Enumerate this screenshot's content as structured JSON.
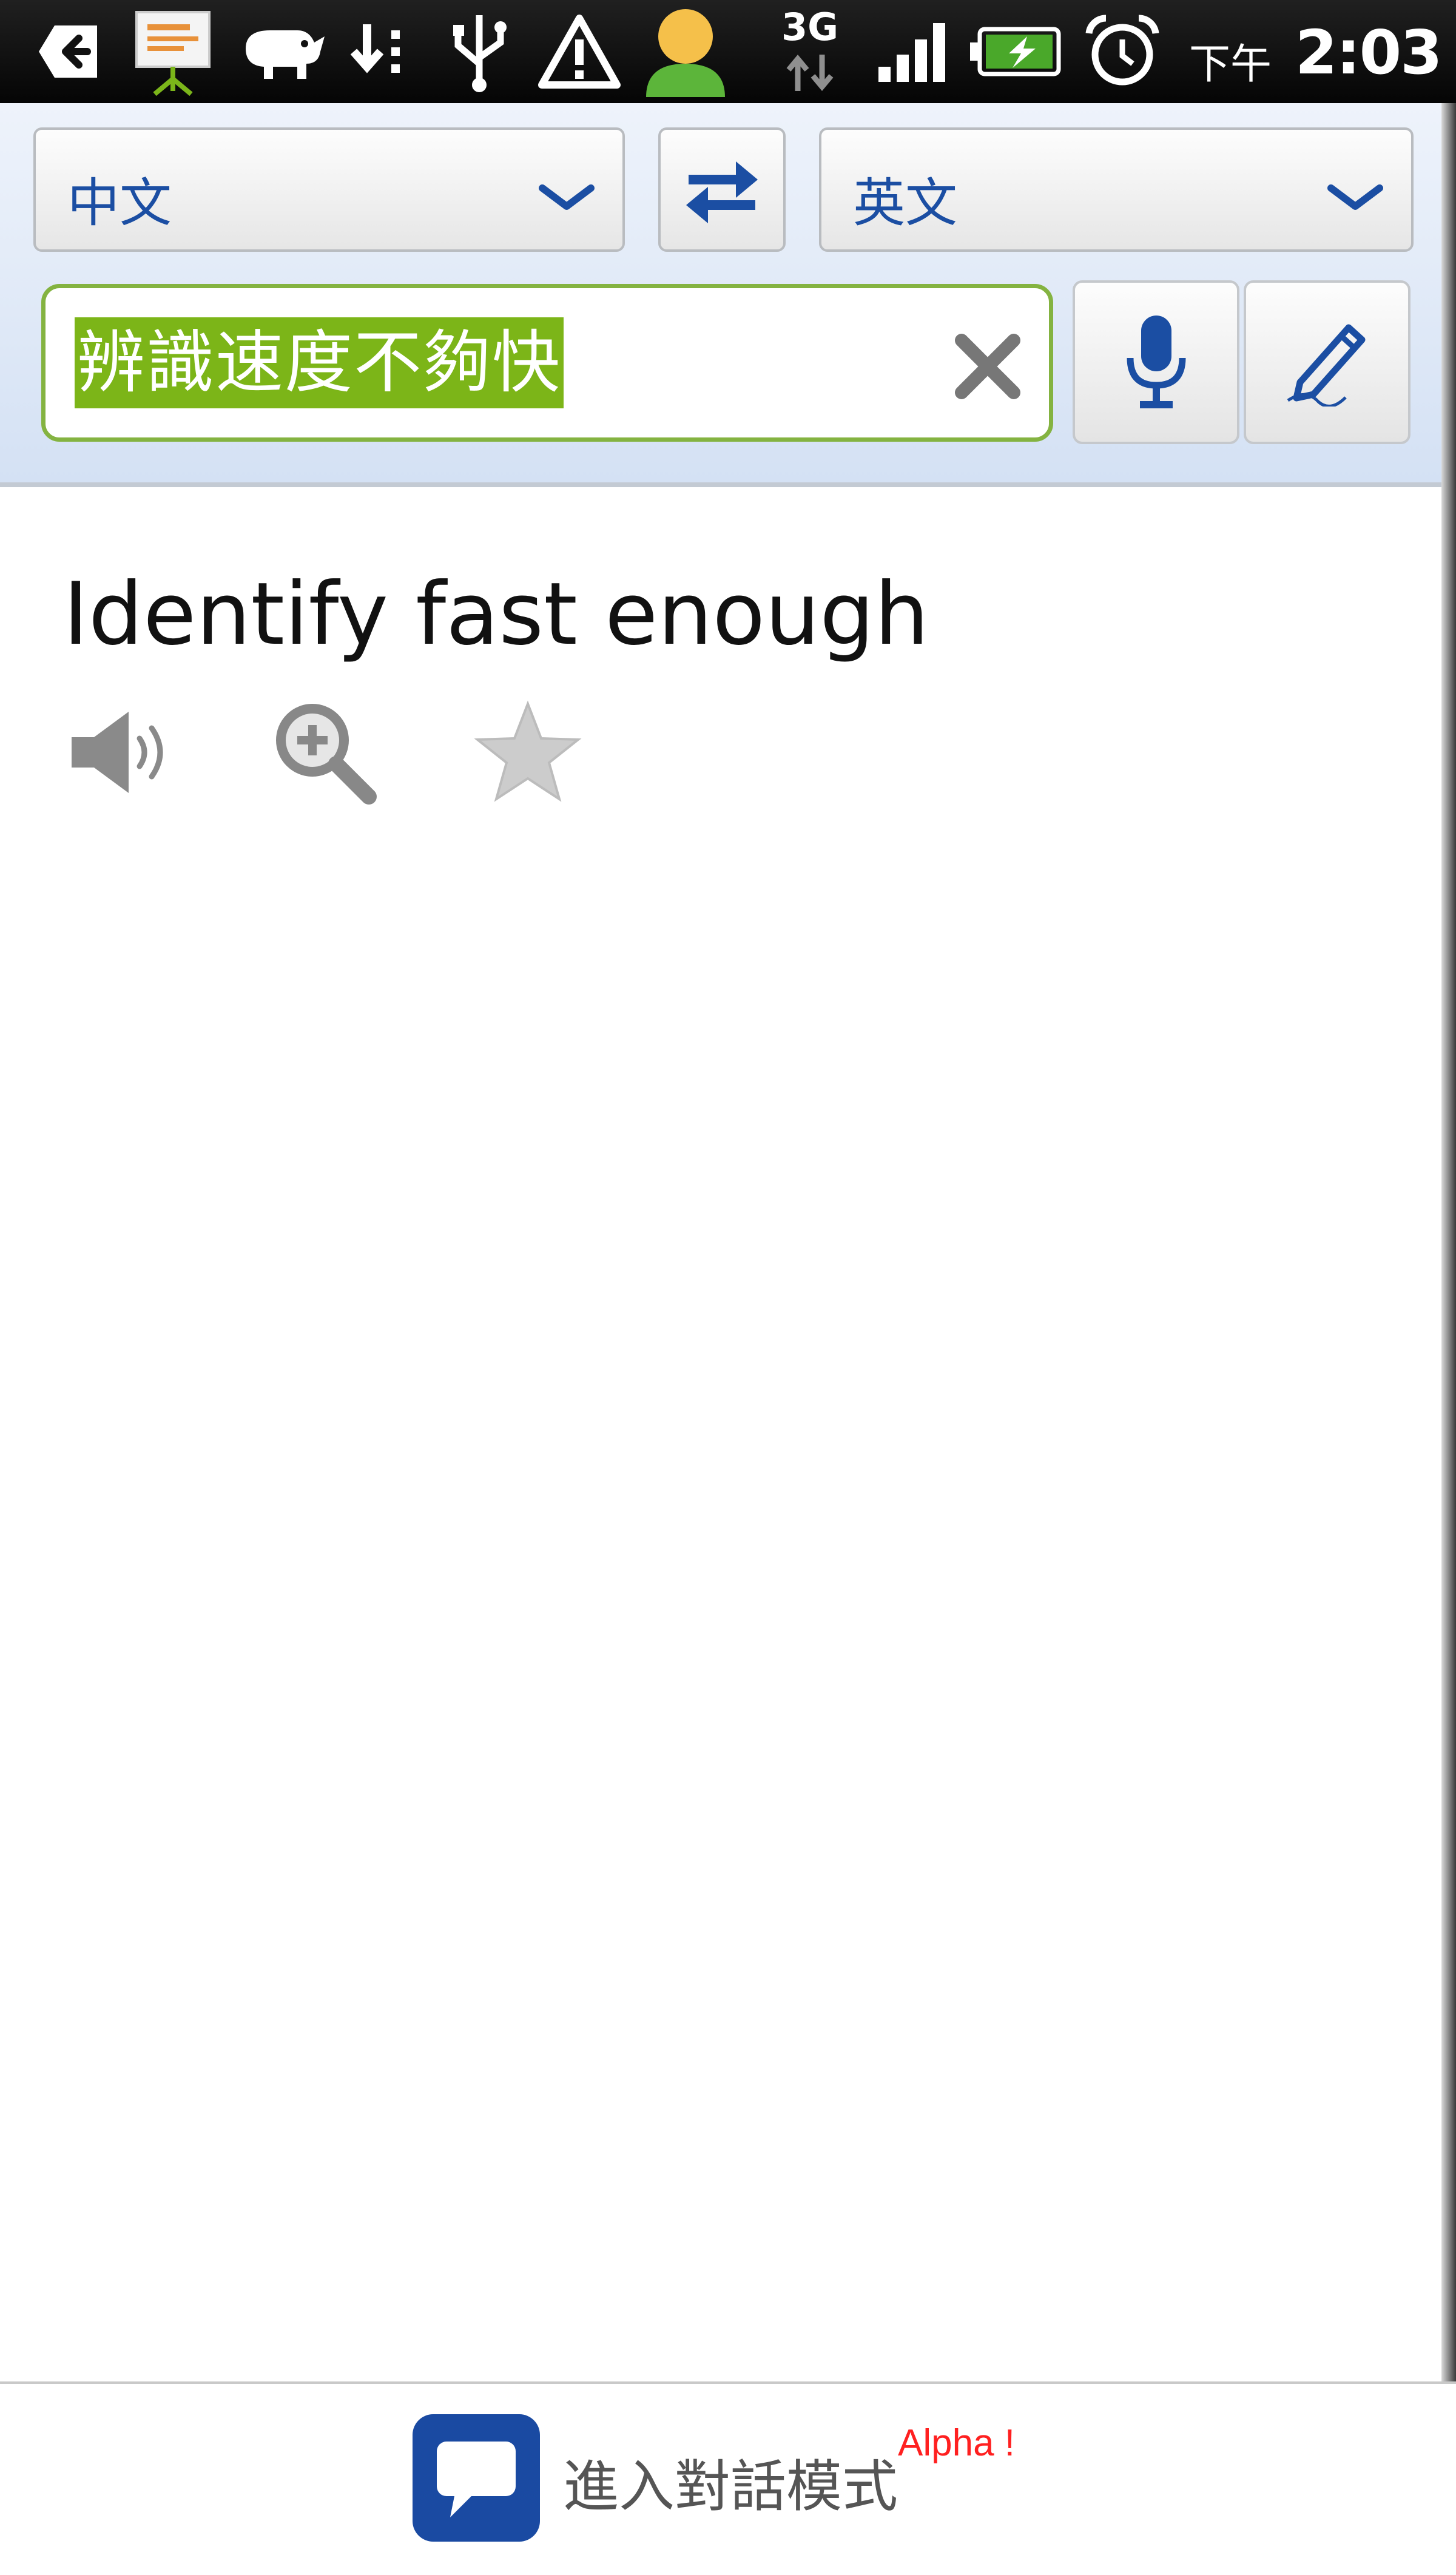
{
  "status_bar": {
    "network_label": "3G",
    "ampm": "下午",
    "time": "2:03",
    "icons": [
      "back-arrow-icon",
      "presentation-icon",
      "rhino-icon",
      "download-icon",
      "usb-icon",
      "warning-icon",
      "contact-avatar-icon",
      "network-activity-icon",
      "signal-strength-icon",
      "battery-charging-icon",
      "alarm-clock-icon"
    ]
  },
  "translator": {
    "source_language": "中文",
    "target_language": "英文",
    "input_text": "辨識速度不夠快",
    "input_selected": true,
    "actions": [
      "swap-languages-icon",
      "clear-icon",
      "microphone-icon",
      "handwriting-pen-icon"
    ]
  },
  "result": {
    "translation": "Identify fast enough",
    "actions": [
      "speaker-icon",
      "zoom-in-icon",
      "star-icon"
    ]
  },
  "footer": {
    "conversation_label": "進入對話模式",
    "badge": "Alpha !"
  },
  "colors": {
    "accent_blue": "#1b4ea3",
    "selection_green": "#7cb518",
    "input_border": "#84b341",
    "badge_red": "#ff2020"
  }
}
